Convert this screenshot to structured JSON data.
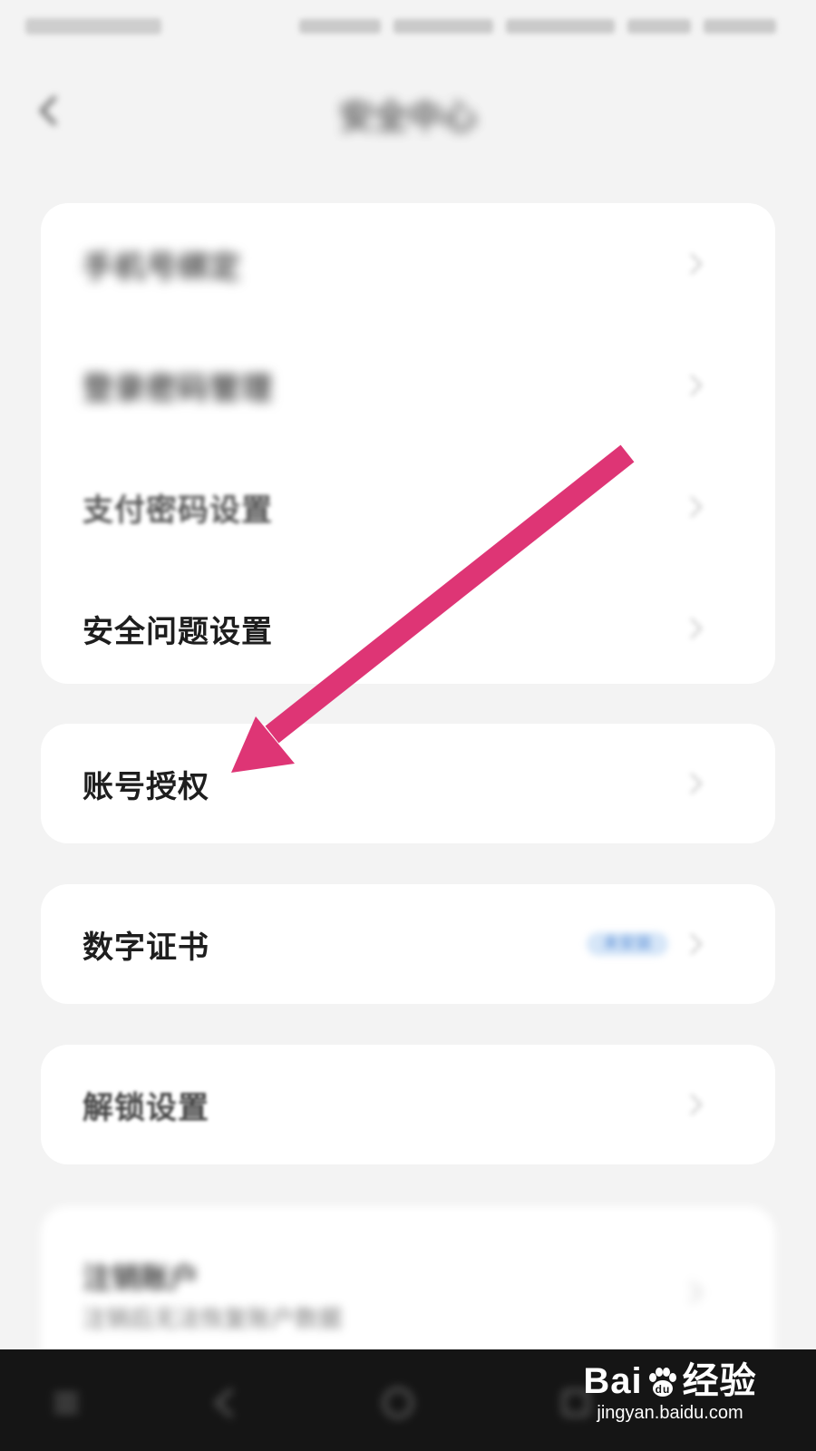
{
  "header": {
    "title": "安全中心"
  },
  "sections": [
    {
      "items": [
        {
          "label": "手机号绑定",
          "blurred": true
        },
        {
          "label": "登录密码管理",
          "blurred": true
        },
        {
          "label": "支付密码设置",
          "blurred": true
        },
        {
          "label": "安全问题设置",
          "blurred": false
        }
      ]
    },
    {
      "items": [
        {
          "label": "账号授权",
          "blurred": false
        }
      ]
    },
    {
      "items": [
        {
          "label": "数字证书",
          "badge": "未安装",
          "blurred": false
        }
      ]
    },
    {
      "items": [
        {
          "label": "解锁设置",
          "blurred": true
        }
      ]
    },
    {
      "items": [
        {
          "label": "注销账户",
          "sub": "注销后无法恢复账户数据",
          "blurred": true
        }
      ]
    }
  ],
  "annotation": {
    "type": "arrow",
    "color": "#de3575"
  },
  "watermark": {
    "brand_left": "Bai",
    "brand_right": "经验",
    "url": "jingyan.baidu.com"
  },
  "nav_bar": {
    "buttons": [
      "menu-icon",
      "back-icon",
      "home-icon",
      "recents-icon"
    ]
  }
}
